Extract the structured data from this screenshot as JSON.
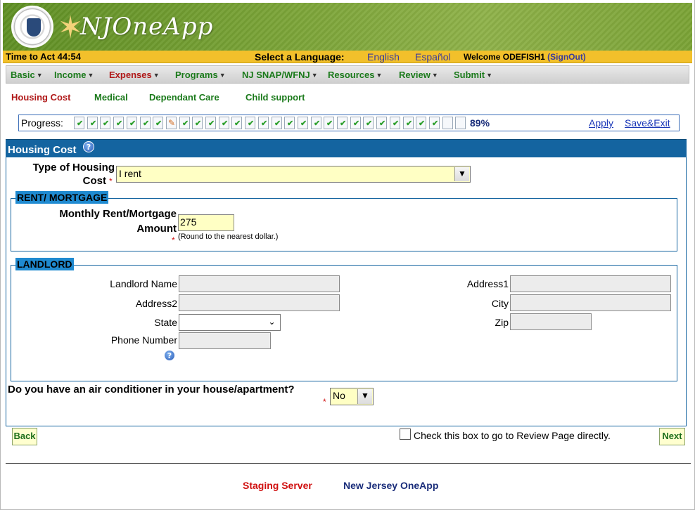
{
  "header": {
    "app_name": "NJOneApp",
    "timer": "Time to Act 44:54",
    "language_label": "Select a Language:",
    "languages": [
      "English",
      "Español"
    ],
    "welcome": "Welcome ODEFISH1",
    "signout": "(SignOut)"
  },
  "menu": [
    {
      "label": "Basic",
      "active": false
    },
    {
      "label": "Income",
      "active": false
    },
    {
      "label": "Expenses",
      "active": true
    },
    {
      "label": "Programs",
      "active": false
    },
    {
      "label": "NJ SNAP/WFNJ",
      "active": false
    },
    {
      "label": "Resources",
      "active": false
    },
    {
      "label": "Review",
      "active": false
    },
    {
      "label": "Submit",
      "active": false
    }
  ],
  "subnav": [
    {
      "label": "Housing Cost",
      "active": true
    },
    {
      "label": "Medical",
      "active": false
    },
    {
      "label": "Dependant Care",
      "active": false
    },
    {
      "label": "Child support",
      "active": false
    }
  ],
  "progress": {
    "label": "Progress:",
    "percent_text": "89%",
    "percent": 89,
    "total_steps": 30,
    "steps_completed": 27,
    "current_step": 8,
    "apply": "Apply",
    "save_exit": "Save&Exit"
  },
  "section": {
    "title": "Housing Cost",
    "help_glyph": "?"
  },
  "form": {
    "housing_type_label_1": "Type of Housing",
    "housing_type_label_2": "Cost",
    "housing_type_value": "I rent",
    "required_mark": "*",
    "rent_legend": "RENT/ MORTGAGE",
    "rent_label_1": "Monthly Rent/Mortgage",
    "rent_label_2": "Amount",
    "rent_value": "275",
    "rent_hint": "(Round to the nearest dollar.)",
    "landlord_legend": "LANDLORD",
    "landlord_name_label": "Landlord Name",
    "address1_label": "Address1",
    "address2_label": "Address2",
    "city_label": "City",
    "state_label": "State",
    "zip_label": "Zip",
    "phone_label": "Phone Number",
    "landlord_name_value": "",
    "address1_value": "",
    "address2_value": "",
    "city_value": "",
    "state_value": "",
    "zip_value": "",
    "phone_value": "",
    "ac_question": "Do you have an air conditioner in your house/apartment?",
    "ac_value": "No"
  },
  "actions": {
    "back": "Back",
    "next": "Next",
    "review_checkbox_label": "Check this box to go to Review Page directly."
  },
  "footer": {
    "server": "Staging Server",
    "brand": "New Jersey OneApp"
  },
  "colors": {
    "accent_blue": "#1464a0",
    "menu_green": "#1b7a1b",
    "active_red": "#b01818",
    "top_bar_yellow": "#f2c02b",
    "input_yellow": "#ffffc4"
  }
}
